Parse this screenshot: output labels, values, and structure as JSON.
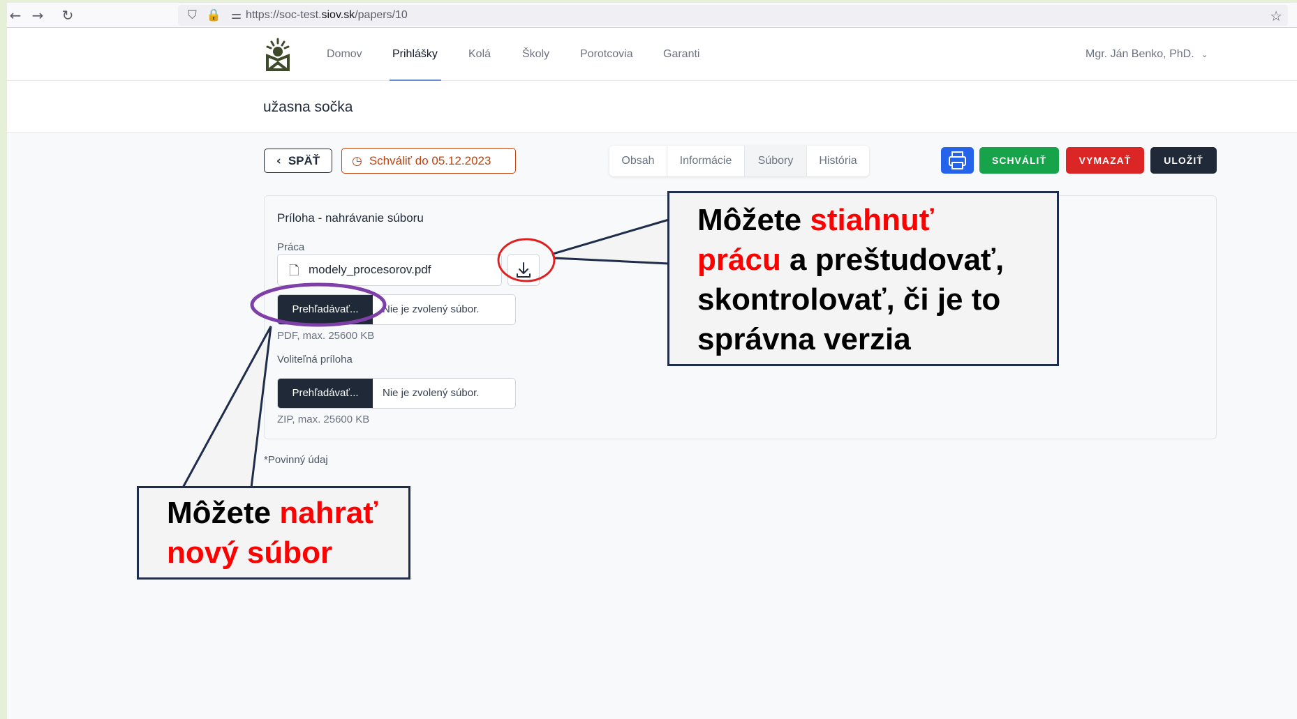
{
  "browser": {
    "url_prefix": "https://soc-test.",
    "url_domain": "siov.sk",
    "url_path": "/papers/10"
  },
  "header": {
    "nav": [
      "Domov",
      "Prihlášky",
      "Kolá",
      "Školy",
      "Porotcovia",
      "Garanti"
    ],
    "active_nav": "Prihlášky",
    "user": "Mgr. Ján Benko, PhD."
  },
  "page": {
    "title": "užasna sočka"
  },
  "toolbar": {
    "back_label": "SPÄŤ",
    "deadline_label": "Schváliť do 05.12.2023",
    "tabs": [
      "Obsah",
      "Informácie",
      "Súbory",
      "História"
    ],
    "active_tab": "Súbory",
    "approve_label": "SCHVÁLIŤ",
    "delete_label": "VYMAZAŤ",
    "save_label": "ULOŽIŤ"
  },
  "card": {
    "title": "Príloha - nahrávanie súboru",
    "work": {
      "label": "Práca",
      "filename": "modely_procesorov.pdf",
      "browse_label": "Prehľadávať...",
      "no_file": "Nie je zvolený súbor.",
      "hint": "PDF, max. 25600 KB"
    },
    "optional": {
      "label": "Voliteľná príloha",
      "browse_label": "Prehľadávať...",
      "no_file": "Nie je zvolený súbor.",
      "hint": "ZIP, max. 25600 KB"
    }
  },
  "required_note": "*Povinný údaj",
  "annotations": {
    "download": {
      "line1_a": "Môžete ",
      "line1_b": "stiahnuť",
      "line2_a": "prácu",
      "line2_b": " a preštudovať,",
      "line3": "skontrolovať, či je to",
      "line4": "správna verzia"
    },
    "upload": {
      "line1_a": "Môžete ",
      "line1_b": "nahrať",
      "line2": "nový súbor"
    }
  },
  "colors": {
    "approve": "#16a34a",
    "delete": "#dc2626",
    "save": "#1f2937",
    "print": "#2563eb",
    "deadline": "#c2410c",
    "highlight_red": "#ff0000",
    "highlight_purple": "#7e3fa8"
  }
}
